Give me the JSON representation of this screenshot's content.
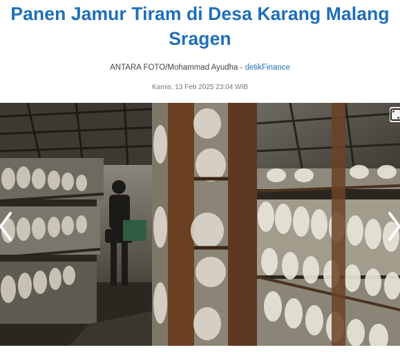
{
  "article": {
    "title": "Panen Jamur Tiram di Desa Karang Malang Sragen",
    "credit": "ANTARA FOTO/Mohammad Ayudha",
    "separator": " - ",
    "source": "detikFinance",
    "date": "Kamis, 13 Feb 2025 23:04 WIB"
  },
  "gallery": {
    "prev_icon": "chevron-left-icon",
    "next_icon": "chevron-right-icon",
    "fullscreen_icon": "expand-icon"
  }
}
